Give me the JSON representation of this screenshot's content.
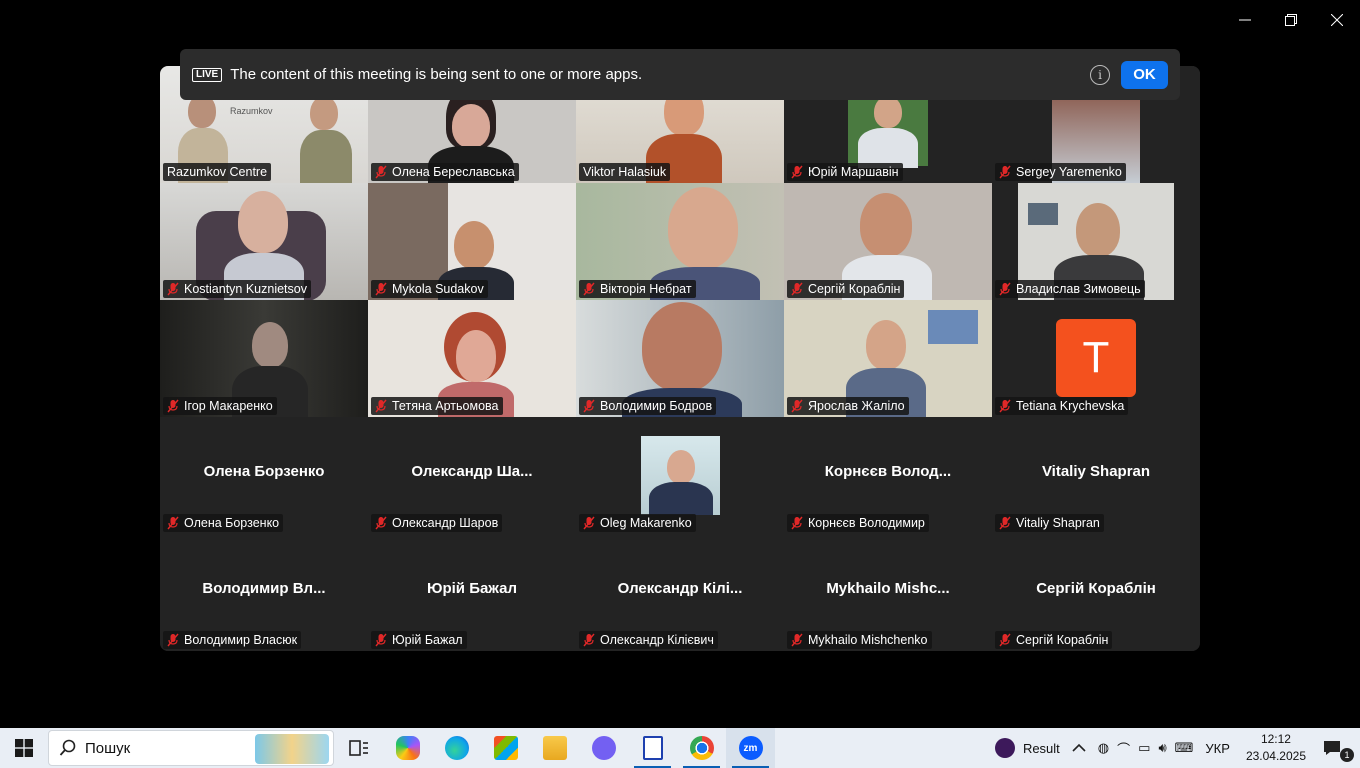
{
  "window": {
    "controls": [
      "minimize",
      "restore",
      "close"
    ]
  },
  "banner": {
    "badge": "LIVE",
    "text": "The content of this meeting is being sent to one or more apps.",
    "ok_label": "OK"
  },
  "participants": [
    {
      "name": "Razumkov Centre",
      "muted": false,
      "video": true
    },
    {
      "name": "Олена Береславська",
      "muted": true,
      "video": true
    },
    {
      "name": "Viktor Halasiuk",
      "muted": false,
      "video": true,
      "active_speaker": true
    },
    {
      "name": "Юрій Маршавін",
      "muted": true,
      "video": true
    },
    {
      "name": "Sergey Yaremenko",
      "muted": true,
      "video": true
    },
    {
      "name": "Kostiantyn Kuznietsov",
      "muted": true,
      "video": true
    },
    {
      "name": "Mykola Sudakov",
      "muted": true,
      "video": true
    },
    {
      "name": "Вікторія Небрат",
      "muted": true,
      "video": true
    },
    {
      "name": "Сергій Кораблін",
      "muted": true,
      "video": true
    },
    {
      "name": "Владислав Зимовець",
      "muted": true,
      "video": true
    },
    {
      "name": "Ігор Макаренко",
      "muted": true,
      "video": true
    },
    {
      "name": "Тетяна Артьомова",
      "muted": true,
      "video": true
    },
    {
      "name": "Володимир Бодров",
      "muted": true,
      "video": true
    },
    {
      "name": "Ярослав Жаліло",
      "muted": true,
      "video": true
    },
    {
      "name": "Tetiana Krychevska",
      "muted": true,
      "video": false,
      "avatar_letter": "T",
      "avatar_color": "#f4511e"
    },
    {
      "name": "Олена Борзенко",
      "muted": true,
      "video": false,
      "display_name": "Олена Борзенко"
    },
    {
      "name": "Олександр Шаров",
      "muted": true,
      "video": false,
      "display_name": "Олександр Ша..."
    },
    {
      "name": "Oleg Makarenko",
      "muted": true,
      "video": false,
      "photo": true
    },
    {
      "name": "Корнєєв Володимир",
      "muted": true,
      "video": false,
      "display_name": "Корнєєв Волод..."
    },
    {
      "name": "Vitaliy Shapran",
      "muted": true,
      "video": false,
      "display_name": "Vitaliy Shapran"
    },
    {
      "name": "Володимир Власюк",
      "muted": true,
      "video": false,
      "display_name": "Володимир Вл..."
    },
    {
      "name": "Юрій Бажал",
      "muted": true,
      "video": false,
      "display_name": "Юрій Бажал"
    },
    {
      "name": "Олександр Кілієвич",
      "muted": true,
      "video": false,
      "display_name": "Олександр Кілі..."
    },
    {
      "name": "Mykhailo Mishchenko",
      "muted": true,
      "video": false,
      "display_name": "Mykhailo Mishc..."
    },
    {
      "name": "Сергій Кораблін",
      "muted": true,
      "video": false,
      "display_name": "Сергій Кораблін"
    }
  ],
  "taskbar": {
    "search_placeholder": "Пошук",
    "apps": [
      "task-view",
      "copilot",
      "edge",
      "store",
      "file-explorer",
      "viber",
      "libreoffice-writer",
      "chrome",
      "zoom"
    ],
    "tray": {
      "widget_label": "Result",
      "language": "УКР",
      "time": "12:12",
      "date": "23.04.2025",
      "notification_count": "1"
    }
  },
  "colors": {
    "accent": "#0e72ed",
    "active_speaker": "#23d959",
    "mute_icon": "#e02828",
    "avatar": "#f4511e"
  }
}
